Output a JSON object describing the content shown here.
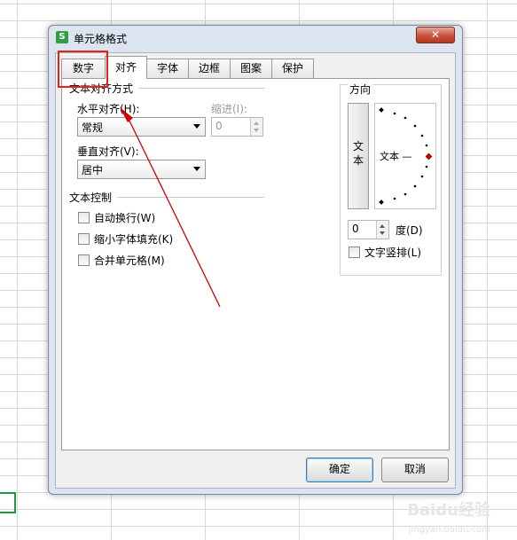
{
  "dialog": {
    "title": "单元格格式",
    "close_icon": "close-icon",
    "app_icon": "wps-spreadsheet-icon",
    "app_icon_glyph": "S"
  },
  "tabs": [
    {
      "label": "数字",
      "active": false
    },
    {
      "label": "对齐",
      "active": true
    },
    {
      "label": "字体",
      "active": false
    },
    {
      "label": "边框",
      "active": false
    },
    {
      "label": "图案",
      "active": false
    },
    {
      "label": "保护",
      "active": false
    }
  ],
  "alignment": {
    "group_title": "文本对齐方式",
    "horizontal_label": "水平对齐(H):",
    "horizontal_value": "常规",
    "indent_label": "缩进(I):",
    "indent_value": "0",
    "vertical_label": "垂直对齐(V):",
    "vertical_value": "居中"
  },
  "text_control": {
    "group_title": "文本控制",
    "options": [
      {
        "label": "自动换行(W)",
        "checked": false
      },
      {
        "label": "缩小字体填充(K)",
        "checked": false
      },
      {
        "label": "合并单元格(M)",
        "checked": false
      }
    ]
  },
  "orientation": {
    "group_title": "方向",
    "vertical_text_chars": [
      "文",
      "本"
    ],
    "dial_label": "文本 —",
    "degree_value": "0",
    "degree_label": "度(D)",
    "vertical_checkbox_label": "文字竖排(L)",
    "vertical_checked": false,
    "indicator_color": "#d10000"
  },
  "buttons": {
    "ok": "确定",
    "cancel": "取消"
  },
  "annotation": {
    "highlight_color": "#e2231a",
    "arrow_color": "#d10000"
  },
  "watermark": {
    "main": "Baidu经验",
    "sub": "jingyan.baidu.com"
  }
}
